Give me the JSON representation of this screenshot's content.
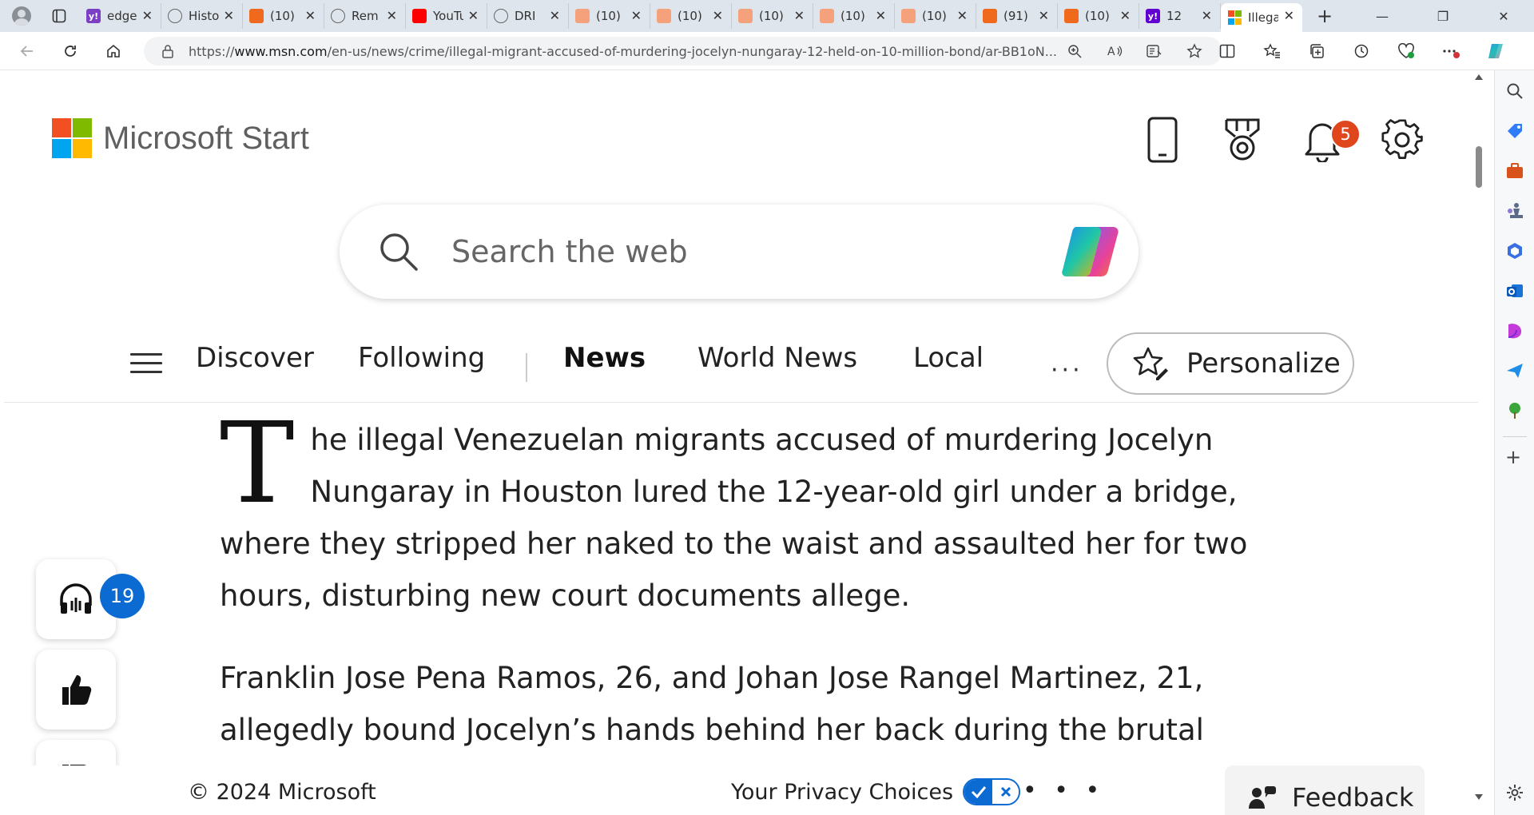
{
  "browser": {
    "tabs": [
      {
        "title": "edge",
        "fav_color": "#7b3fc4",
        "fav_glyph": "y!",
        "active": false
      },
      {
        "title": "History",
        "fav_color": "#ffffff",
        "fav_glyph": "",
        "active": false
      },
      {
        "title": "(10)",
        "fav_color": "#f06a1d",
        "fav_glyph": "",
        "active": false
      },
      {
        "title": "Rem",
        "fav_color": "#ffffff",
        "fav_glyph": "",
        "active": false
      },
      {
        "title": "YouTube",
        "fav_color": "#ff0000",
        "fav_glyph": "",
        "active": false
      },
      {
        "title": "DRI",
        "fav_color": "#ffffff",
        "fav_glyph": "",
        "active": false
      },
      {
        "title": "(10)",
        "fav_color": "#f5a27c",
        "fav_glyph": "",
        "active": false
      },
      {
        "title": "(10)",
        "fav_color": "#f5a27c",
        "fav_glyph": "",
        "active": false
      },
      {
        "title": "(10)",
        "fav_color": "#f5a27c",
        "fav_glyph": "",
        "active": false
      },
      {
        "title": "(10)",
        "fav_color": "#f5a27c",
        "fav_glyph": "",
        "active": false
      },
      {
        "title": "(10)",
        "fav_color": "#f5a27c",
        "fav_glyph": "",
        "active": false
      },
      {
        "title": "(91)",
        "fav_color": "#f06a1d",
        "fav_glyph": "",
        "active": false
      },
      {
        "title": "(10)",
        "fav_color": "#f06a1d",
        "fav_glyph": "",
        "active": false
      },
      {
        "title": "12",
        "fav_color": "#6001d2",
        "fav_glyph": "y!",
        "active": false
      },
      {
        "title": "Illegal",
        "fav_color": "ms",
        "fav_glyph": "",
        "active": true
      }
    ],
    "url_prefix": "https://",
    "url_domain": "www.msn.com",
    "url_path": "/en-us/news/crime/illegal-migrant-accused-of-murdering-jocelyn-nungaray-12-held-on-10-million-bond/ar-BB1oN..."
  },
  "header": {
    "brand": "Microsoft Start",
    "notifications_count": "5"
  },
  "search": {
    "placeholder": "Search the web"
  },
  "nav": {
    "items": [
      "Discover",
      "Following",
      "News",
      "World News",
      "Local"
    ],
    "more": "···",
    "personalize": "Personalize"
  },
  "article": {
    "dropcap": "T",
    "p1_rest": "he illegal Venezuelan migrants accused of murdering Jocelyn Nungaray in Houston lured the 12-year-old girl under a bridge, where they stripped her naked to the waist and assaulted her for two hours, disturbing new court documents allege.",
    "p2": "Franklin Jose Pena Ramos, 26, and Johan Jose Rangel Martinez, 21, allegedly bound Jocelyn’s hands behind her back during the brutal"
  },
  "actions": {
    "likes": "19"
  },
  "footer": {
    "copyright": "© 2024 Microsoft",
    "privacy": "Your Privacy Choices",
    "more": "• • •",
    "feedback": "Feedback"
  },
  "colors": {
    "accent": "#0b6bd3",
    "badge": "#e0461b",
    "ms_red": "#f25022",
    "ms_green": "#7fba00",
    "ms_blue": "#00a4ef",
    "ms_yellow": "#ffb900"
  }
}
